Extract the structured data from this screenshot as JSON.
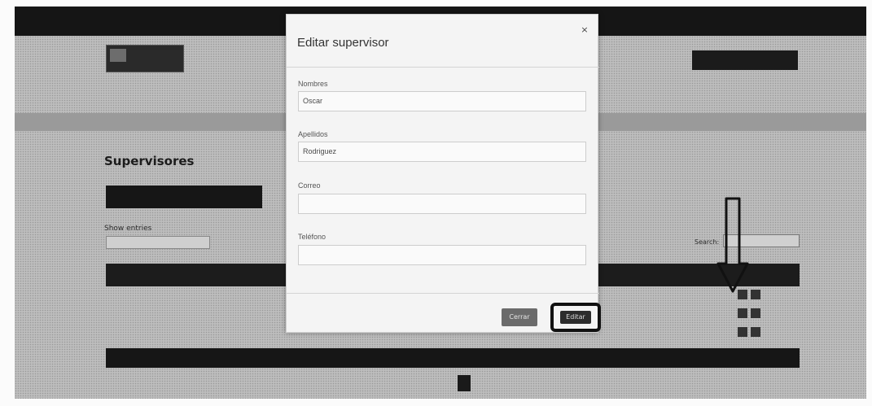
{
  "topbar": {
    "text": ""
  },
  "header": {
    "logo_title": "",
    "logo_subtitle": "",
    "user_badge": ""
  },
  "nav": {
    "items": [
      "",
      "",
      ""
    ]
  },
  "breadcrumb": "",
  "page": {
    "title": "Supervisores",
    "create_button": "",
    "show_entries_label": "Show entries",
    "entries_value": "",
    "search_label": "Search:"
  },
  "table": {
    "columns": [
      "",
      "",
      ""
    ],
    "rows": [
      {
        "name": ""
      },
      {
        "name": ""
      },
      {
        "name": ""
      }
    ],
    "footer_columns": [
      "",
      "",
      ""
    ]
  },
  "pagination": {
    "showing": "",
    "previous": "",
    "current": "",
    "next": ""
  },
  "modal": {
    "title": "Editar supervisor",
    "close_label": "×",
    "fields": [
      {
        "label": "Nombres",
        "value": "Oscar"
      },
      {
        "label": "Apellidos",
        "value": "Rodriguez"
      },
      {
        "label": "Correo",
        "value": ""
      },
      {
        "label": "Teléfono",
        "value": ""
      }
    ],
    "cancel_button": "Cerrar",
    "submit_button": "Editar"
  },
  "colors": {
    "topbar": "#151515",
    "overlay_background": "#bdbdbd",
    "modal_background": "#f4f4f4",
    "highlight_border": "#111111"
  }
}
